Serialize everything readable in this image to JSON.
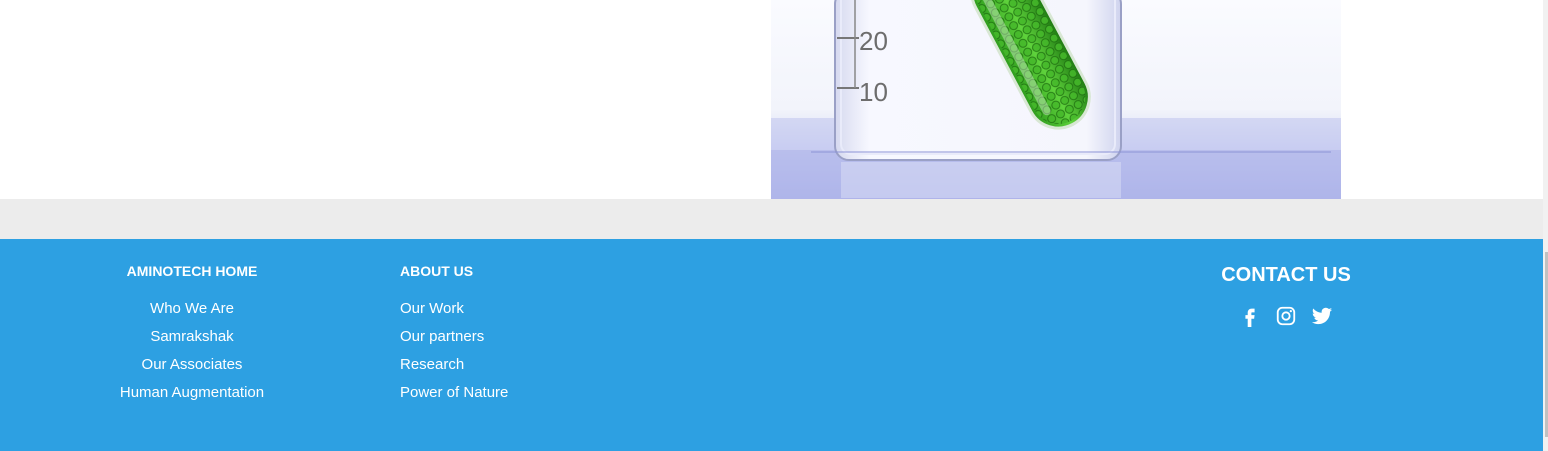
{
  "footer": {
    "home": {
      "heading": "AMINOTECH HOME",
      "links": [
        "Who We Are",
        "Samrakshak",
        "Our Associates",
        "Human Augmentation"
      ]
    },
    "about": {
      "heading": "ABOUT US",
      "links": [
        "Our Work",
        "Our partners",
        "Research",
        "Power of Nature"
      ]
    },
    "contact": {
      "heading": "CONTACT US",
      "social": [
        "facebook-icon",
        "instagram-icon",
        "twitter-icon"
      ]
    }
  },
  "hero_image": {
    "scale_labels": [
      "20",
      "10"
    ]
  },
  "colors": {
    "footer_bg": "#2da0e2",
    "band_bg": "#ececec",
    "text": "#ffffff"
  }
}
